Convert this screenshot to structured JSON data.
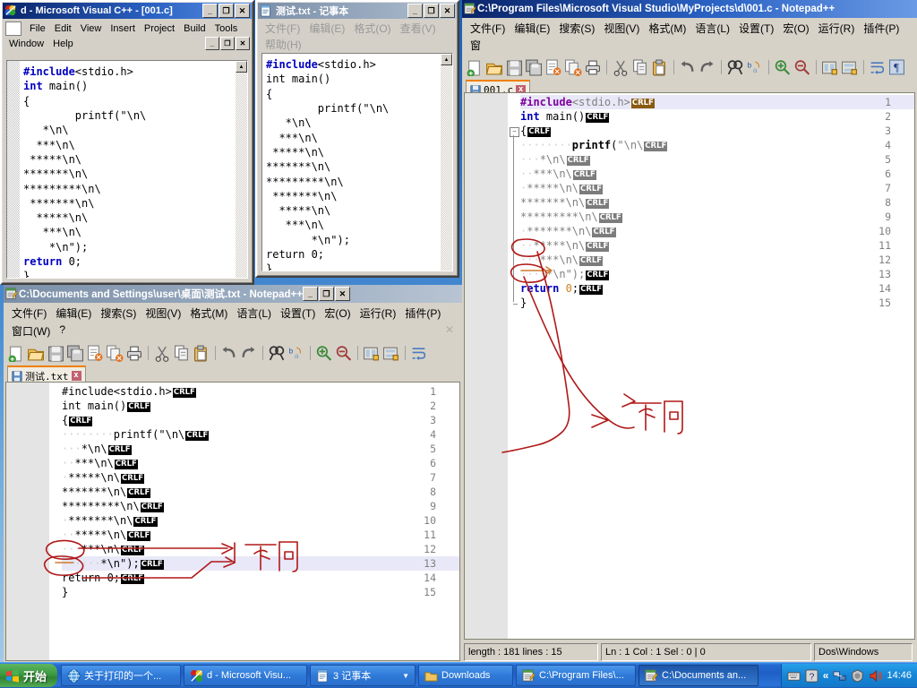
{
  "desktop": {
    "background_color": "#2a6fc0"
  },
  "vc_window": {
    "title": "d - Microsoft Visual C++ - [001.c]",
    "icon": "vc-app-icon",
    "caption_buttons": [
      "minimize",
      "maximize",
      "close"
    ],
    "menus": [
      "File",
      "Edit",
      "View",
      "Insert",
      "Project",
      "Build",
      "Tools",
      "Window",
      "Help"
    ],
    "mdi_buttons": [
      "minimize",
      "restore",
      "close"
    ],
    "code_lines": [
      "#include<stdio.h>",
      "int main()",
      "{",
      "        printf(\"\\n\\",
      "   *\\n\\",
      "  ***\\n\\",
      " *****\\n\\",
      "*******\\n\\",
      "*********\\n\\",
      " *******\\n\\",
      "  *****\\n\\",
      "   ***\\n\\",
      "    *\\n\");",
      "return 0;",
      "}"
    ]
  },
  "notepad_window": {
    "title": "测试.txt - 记事本",
    "icon": "notepad-icon",
    "caption_buttons": [
      "minimize",
      "maximize",
      "close"
    ],
    "menus": [
      "文件(F)",
      "编辑(E)",
      "格式(O)",
      "查看(V)",
      "帮助(H)"
    ],
    "code_lines": [
      "#include<stdio.h>",
      "int main()",
      "{",
      "        printf(\"\\n\\",
      "   *\\n\\",
      "  ***\\n\\",
      " *****\\n\\",
      "*******\\n\\",
      "*********\\n\\",
      " *******\\n\\",
      "  *****\\n\\",
      "   ***\\n\\",
      "       *\\n\");",
      "return 0;",
      "}"
    ]
  },
  "npp_right": {
    "title": "C:\\Program Files\\Microsoft Visual Studio\\MyProjects\\d\\001.c - Notepad++",
    "icon": "notepadpp-icon",
    "caption_buttons": [
      "minimize",
      "maximize",
      "close"
    ],
    "menus": [
      "文件(F)",
      "编辑(E)",
      "搜索(S)",
      "视图(V)",
      "格式(M)",
      "语言(L)",
      "设置(T)",
      "宏(O)",
      "运行(R)",
      "插件(P)",
      "窗"
    ],
    "toolbar_icons": [
      "new-file-icon",
      "open-file-icon",
      "save-icon",
      "save-all-icon",
      "close-file-icon",
      "close-all-icon",
      "print-icon",
      "cut-icon",
      "copy-icon",
      "paste-icon",
      "undo-icon",
      "redo-icon",
      "find-icon",
      "replace-icon",
      "zoom-in-icon",
      "zoom-out-icon",
      "sync-v-scroll-icon",
      "sync-h-scroll-icon",
      "word-wrap-icon",
      "show-all-chars-icon"
    ],
    "tab": {
      "label": "001.c",
      "close": "x",
      "icon": "save-blue-icon"
    },
    "lines": [
      {
        "n": "1",
        "indent": 0,
        "text": "#include<stdio.h>",
        "eol": "CRLF",
        "eol_style": "o",
        "style": "pre",
        "highlight": true
      },
      {
        "n": "2",
        "indent": 0,
        "text": "int main()",
        "eol": "CRLF",
        "eol_style": "k",
        "style": "kw"
      },
      {
        "n": "3",
        "indent": 0,
        "text": "{",
        "eol": "CRLF",
        "eol_style": "k",
        "style": "plain",
        "fold": "open"
      },
      {
        "n": "4",
        "indent": 0,
        "text": "        printf(\"\\n\\",
        "eol": "CRLF",
        "eol_style": "g",
        "style": "func"
      },
      {
        "n": "5",
        "indent": 0,
        "text": "   *\\n\\",
        "eol": "CRLF",
        "eol_style": "g",
        "style": "str"
      },
      {
        "n": "6",
        "indent": 0,
        "text": "  ***\\n\\",
        "eol": "CRLF",
        "eol_style": "g",
        "style": "str"
      },
      {
        "n": "7",
        "indent": 0,
        "text": " *****\\n\\",
        "eol": "CRLF",
        "eol_style": "g",
        "style": "str"
      },
      {
        "n": "8",
        "indent": 0,
        "text": "*******\\n\\",
        "eol": "CRLF",
        "eol_style": "g",
        "style": "str"
      },
      {
        "n": "9",
        "indent": 0,
        "text": "*********\\n\\",
        "eol": "CRLF",
        "eol_style": "g",
        "style": "str"
      },
      {
        "n": "10",
        "indent": 0,
        "text": " *******\\n\\",
        "eol": "CRLF",
        "eol_style": "g",
        "style": "str"
      },
      {
        "n": "11",
        "indent": 0,
        "text": "  *****\\n\\",
        "eol": "CRLF",
        "eol_style": "g",
        "style": "str"
      },
      {
        "n": "12",
        "indent": 0,
        "text": "   ***\\n\\",
        "eol": "CRLF",
        "eol_style": "g",
        "style": "str"
      },
      {
        "n": "13",
        "indent": 0,
        "text": "    *\\n\");",
        "eol": "CRLF",
        "eol_style": "k",
        "style": "str"
      },
      {
        "n": "14",
        "indent": 0,
        "text": "return 0;",
        "eol": "CRLF",
        "eol_style": "k",
        "style": "ret"
      },
      {
        "n": "15",
        "indent": 0,
        "text": "}",
        "eol": "",
        "eol_style": "",
        "style": "plain",
        "fold": "end"
      }
    ],
    "status": {
      "length_lines": "length : 181   lines : 15",
      "caret": "Ln : 1    Col : 1    Sel : 0 | 0",
      "eol_format": "Dos\\Windows"
    },
    "annotation": "不同"
  },
  "npp_bottom": {
    "title": "C:\\Documents and Settings\\user\\桌面\\测试.txt - Notepad++",
    "icon": "notepadpp-icon",
    "caption_buttons": [
      "minimize",
      "maximize",
      "close"
    ],
    "menus": [
      "文件(F)",
      "编辑(E)",
      "搜索(S)",
      "视图(V)",
      "格式(M)",
      "语言(L)",
      "设置(T)",
      "宏(O)",
      "运行(R)",
      "插件(P)",
      "窗口(W)",
      "?"
    ],
    "toolbar_icons": [
      "new-file-icon",
      "open-file-icon",
      "save-icon",
      "save-all-icon",
      "close-file-icon",
      "close-all-icon",
      "print-icon",
      "cut-icon",
      "copy-icon",
      "paste-icon",
      "undo-icon",
      "redo-icon",
      "find-icon",
      "replace-icon",
      "zoom-in-icon",
      "zoom-out-icon",
      "sync-v-scroll-icon",
      "sync-h-scroll-icon",
      "word-wrap-icon"
    ],
    "tab": {
      "label": "测试.txt",
      "close": "x",
      "icon": "save-blue-icon"
    },
    "lines": [
      {
        "n": "1",
        "text": "#include<stdio.h>",
        "eol": "CRLF",
        "eol_style": "k"
      },
      {
        "n": "2",
        "text": "int main()",
        "eol": "CRLF",
        "eol_style": "k"
      },
      {
        "n": "3",
        "text": "{",
        "eol": "CRLF",
        "eol_style": "k"
      },
      {
        "n": "4",
        "text": "        printf(\"\\n\\",
        "eol": "CRLF",
        "eol_style": "k"
      },
      {
        "n": "5",
        "text": "   *\\n\\",
        "eol": "CRLF",
        "eol_style": "k"
      },
      {
        "n": "6",
        "text": "  ***\\n\\",
        "eol": "CRLF",
        "eol_style": "k"
      },
      {
        "n": "7",
        "text": " *****\\n\\",
        "eol": "CRLF",
        "eol_style": "k"
      },
      {
        "n": "8",
        "text": "*******\\n\\",
        "eol": "CRLF",
        "eol_style": "k"
      },
      {
        "n": "9",
        "text": "*********\\n\\",
        "eol": "CRLF",
        "eol_style": "k"
      },
      {
        "n": "10",
        "text": " *******\\n\\",
        "eol": "CRLF",
        "eol_style": "k"
      },
      {
        "n": "11",
        "text": "  *****\\n\\",
        "eol": "CRLF",
        "eol_style": "k"
      },
      {
        "n": "12",
        "text": "   ***\\n\\",
        "eol": "CRLF",
        "eol_style": "k"
      },
      {
        "n": "13",
        "text": "      *\\n\");",
        "eol": "CRLF",
        "eol_style": "k",
        "highlight": true
      },
      {
        "n": "14",
        "text": "return 0;",
        "eol": "CRLF",
        "eol_style": "k"
      },
      {
        "n": "15",
        "text": "}",
        "eol": "",
        "eol_style": ""
      }
    ],
    "annotation": "不同"
  },
  "taskbar": {
    "start_label": "开始",
    "start_icon": "windows-flag-icon",
    "buttons": [
      {
        "label": "关于打印的一个...",
        "icon": "ie-globe-icon",
        "pressed": false,
        "dropdown": false
      },
      {
        "label": "d - Microsoft Visu...",
        "icon": "vc-app-icon",
        "pressed": false,
        "dropdown": false
      },
      {
        "label": "3 记事本",
        "icon": "notepad-icon",
        "pressed": false,
        "dropdown": true
      },
      {
        "label": "Downloads",
        "icon": "folder-icon",
        "pressed": false,
        "dropdown": false
      },
      {
        "label": "C:\\Program Files\\...",
        "icon": "notepadpp-icon",
        "pressed": false,
        "dropdown": false
      },
      {
        "label": "C:\\Documents an...",
        "icon": "notepadpp-icon",
        "pressed": true,
        "dropdown": false
      }
    ],
    "tray": {
      "icons": [
        "keyboard-icon",
        "help-icon",
        "show-hidden-icon",
        "network-icon",
        "shield-icon",
        "volume-icon"
      ],
      "clock": "14:46"
    }
  }
}
